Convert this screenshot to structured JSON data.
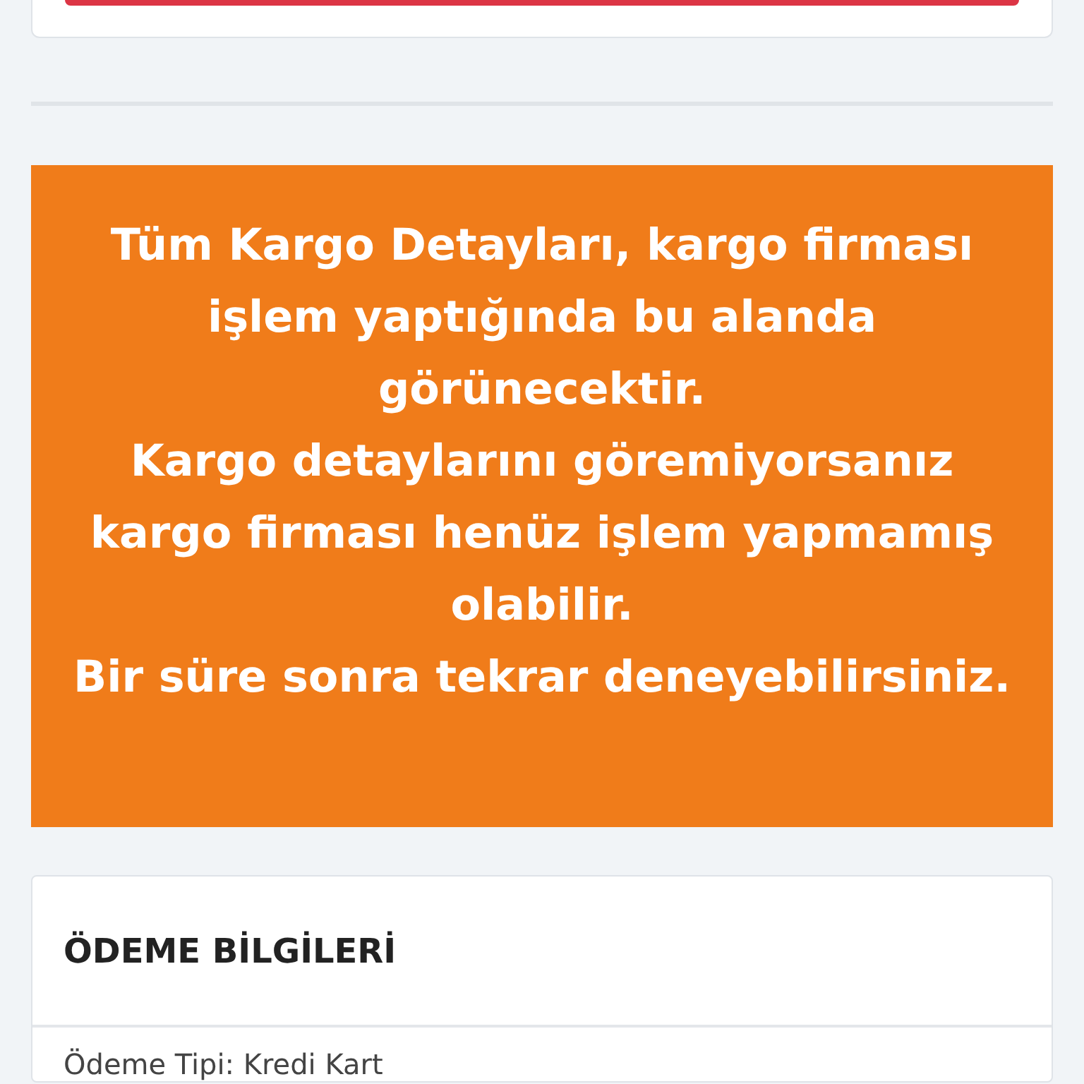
{
  "notice": {
    "paragraphs": [
      "Tüm Kargo Detayları, kargo firması işlem yaptığında bu alanda görünecektir.",
      "Kargo detaylarını göremiyorsanız kargo firması henüz işlem yapmamış olabilir.",
      "Bir süre sonra tekrar deneyebilirsiniz."
    ]
  },
  "payment": {
    "title": "ÖDEME BİLGİLERİ",
    "rows": [
      "Ödeme Tipi: Kredi Kart"
    ]
  }
}
